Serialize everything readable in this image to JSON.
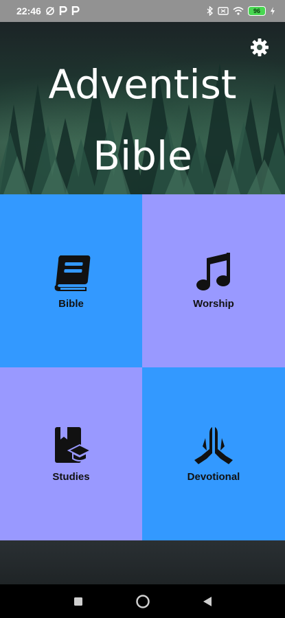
{
  "status_bar": {
    "time": "22:46",
    "battery": "96",
    "icons": [
      "sync-icon",
      "parking-p-icon",
      "parking-p-icon",
      "bluetooth-icon",
      "sim-icon",
      "wifi-icon",
      "battery-icon",
      "charging-icon"
    ]
  },
  "header": {
    "title_line1": "Adventist",
    "title_line2": "Bible",
    "settings_icon": "gear-icon"
  },
  "tiles": [
    {
      "label": "Bible",
      "icon": "book-icon",
      "color": "#3399FF"
    },
    {
      "label": "Worship",
      "icon": "music-notes-icon",
      "color": "#9999FF"
    },
    {
      "label": "Studies",
      "icon": "book-graduation-cap-icon",
      "color": "#9999FF"
    },
    {
      "label": "Devotional",
      "icon": "praying-hands-icon",
      "color": "#3399FF"
    }
  ],
  "nav": {
    "icons": [
      "recents-square-icon",
      "home-circle-icon",
      "back-triangle-icon"
    ]
  },
  "colors": {
    "blue_tile": "#3399FF",
    "purple_tile": "#9999FF",
    "status_bar": "#929292",
    "nav_bar": "#000000"
  }
}
